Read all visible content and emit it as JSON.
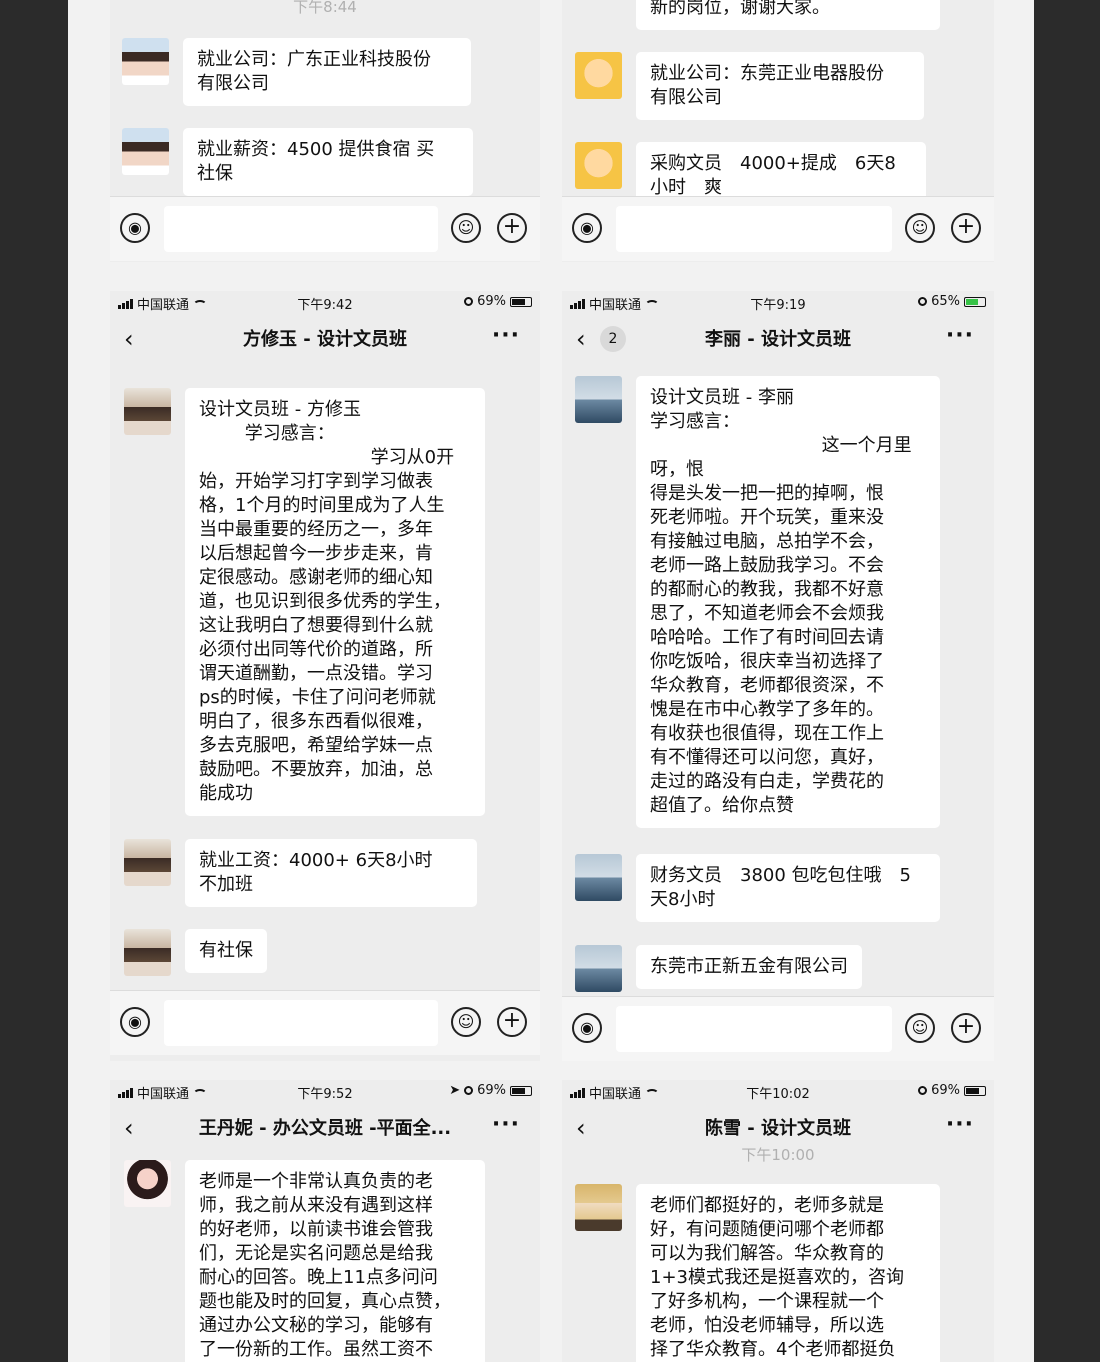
{
  "panels": {
    "tl": {
      "timestamp": "下午8:44",
      "messages": [
        {
          "avatar": "girl-avatar",
          "text": "就业公司：广东正业科技股份\n有限公司"
        },
        {
          "avatar": "girl-avatar",
          "text": "就业薪资：4500 提供食宿 买\n社保"
        }
      ]
    },
    "tr": {
      "messages": [
        {
          "avatar": "none",
          "text": "新的岗位，谢谢大家。"
        },
        {
          "avatar": "cat-avatar",
          "text": "就业公司：东莞正业电器股份\n有限公司"
        },
        {
          "avatar": "cat-avatar",
          "text": "采购文员　4000+提成　6天8\n小时　爽"
        }
      ]
    },
    "ml": {
      "status": {
        "carrier": "中国联通",
        "time": "下午9:42",
        "battery": "69%"
      },
      "title": "方修玉 - 设计文员班",
      "more": "···",
      "messages": [
        {
          "text": "设计文员班 - 方修玉\n        学习感言：\n                              学习从0开\n始，开始学习打字到学习做表\n格，1个月的时间里成为了人生\n当中最重要的经历之一，多年\n以后想起曾今一步步走来，肯\n定很感动。感谢老师的细心知\n道，也见识到很多优秀的学生，\n这让我明白了想要得到什么就\n必须付出同等代价的道路，所\n谓天道酬勤，一点没错。学习\nps的时候，卡住了问问老师就\n明白了，很多东西看似很难，\n多去克服吧，希望给学妹一点\n鼓励吧。不要放弃，加油，总\n能成功"
        },
        {
          "text": "就业工资：4000+ 6天8小时\n不加班"
        },
        {
          "text": "有社保"
        }
      ]
    },
    "mr": {
      "status": {
        "carrier": "中国联通",
        "time": "下午9:19",
        "battery": "65%"
      },
      "title": "李丽 - 设计文员班",
      "unread": "2",
      "more": "···",
      "messages": [
        {
          "text": "设计文员班 - 李丽\n学习感言：\n                              这一个月里呀，恨\n得是头发一把一把的掉啊，恨\n死老师啦。开个玩笑，重来没\n有接触过电脑，总拍学不会，\n老师一路上鼓励我学习。不会\n的都耐心的教我，我都不好意\n思了，不知道老师会不会烦我\n哈哈哈。工作了有时间回去请\n你吃饭哈，很庆幸当初选择了\n华众教育，老师都很资深，不\n愧是在市中心教学了多年的。\n有收获也很值得，现在工作上\n有不懂得还可以问您，真好，\n走过的路没有白走，学费花的\n超值了。给你点赞\n"
        },
        {
          "text": "财务文员　3800 包吃包住哦　5\n天8小时"
        },
        {
          "text": "东莞市正新五金有限公司"
        }
      ]
    },
    "bl": {
      "status": {
        "carrier": "中国联通",
        "time": "下午9:52",
        "battery": "69%"
      },
      "title": "王丹妮 - 办公文员班 -平面全...",
      "more": "···",
      "messages": [
        {
          "text": "老师是一个非常认真负责的老\n师，我之前从来没有遇到这样\n的好老师，以前读书谁会管我\n们，无论是实名问题总是给我\n耐心的回答。晚上11点多问问\n题也能及时的回复，真心点赞，\n通过办公文秘的学习，能够有\n了一份新的工作。虽然工资不"
        }
      ]
    },
    "br": {
      "status": {
        "carrier": "中国联通",
        "time": "下午10:02",
        "battery": "69%"
      },
      "title": "陈雪 - 设计文员班",
      "timestamp": "下午10:00",
      "more": "···",
      "messages": [
        {
          "text": "老师们都挺好的，老师多就是\n好，有问题随便问哪个老师都\n可以为我们解答。华众教育的\n1+3模式我还是挺喜欢的，咨询\n了好多机构，一个课程就一个\n老师，怕没老师辅导，所以选\n择了华众教育。4个老师都挺负"
        }
      ]
    }
  },
  "back_glyph": "‹",
  "plus_glyph": "+",
  "emoji_glyph": "☺",
  "voice_glyph": "◉"
}
